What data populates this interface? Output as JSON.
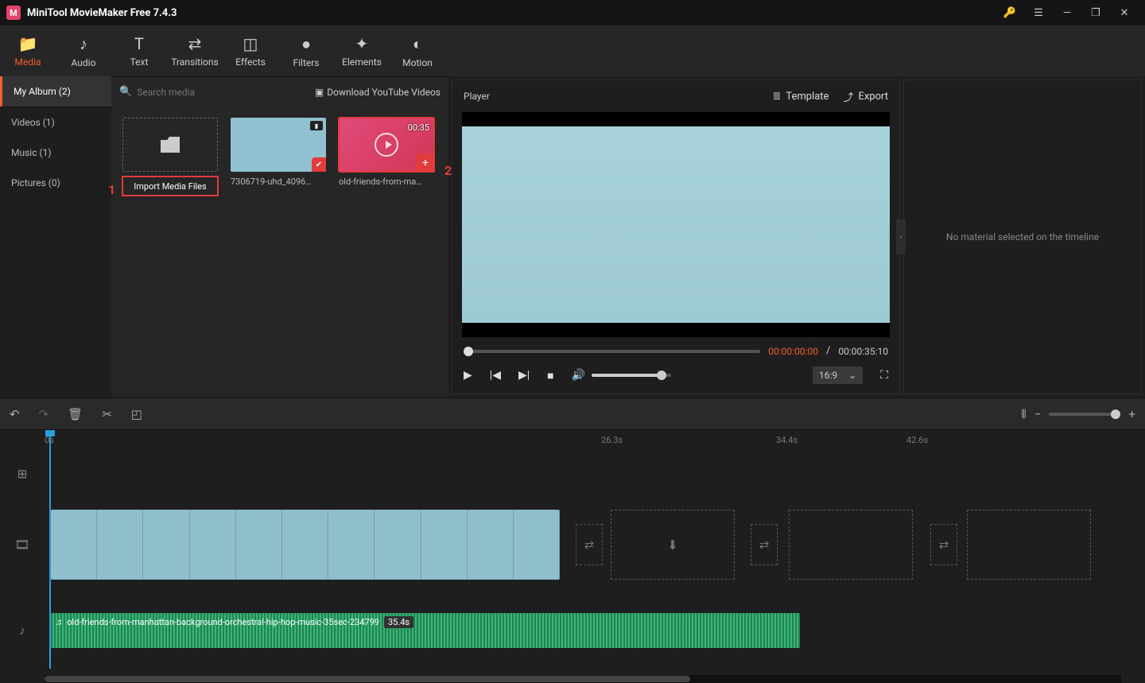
{
  "app": {
    "title": "MiniTool MovieMaker Free 7.4.3"
  },
  "toolbar": {
    "tabs": [
      {
        "label": "Media",
        "icon": "📁"
      },
      {
        "label": "Audio",
        "icon": "♪"
      },
      {
        "label": "Text",
        "icon": "T"
      },
      {
        "label": "Transitions",
        "icon": "⇄"
      },
      {
        "label": "Effects",
        "icon": "◫"
      },
      {
        "label": "Filters",
        "icon": "●"
      },
      {
        "label": "Elements",
        "icon": "✦"
      },
      {
        "label": "Motion",
        "icon": "◐"
      }
    ],
    "active": 0
  },
  "media": {
    "side": [
      {
        "label": "My Album (2)",
        "active": true
      },
      {
        "label": "Videos (1)"
      },
      {
        "label": "Music (1)"
      },
      {
        "label": "Pictures (0)"
      }
    ],
    "search_placeholder": "Search media",
    "download_label": "Download YouTube Videos",
    "import_label": "Import Media Files",
    "items": {
      "video": {
        "label": "7306719-uhd_4096…"
      },
      "audio": {
        "label": "old-friends-from-ma…",
        "duration": "00:35"
      }
    },
    "callouts": {
      "one": "1",
      "two": "2"
    }
  },
  "player": {
    "title": "Player",
    "template_label": "Template",
    "export_label": "Export",
    "time_current": "00:00:00:00",
    "time_sep": " / ",
    "time_total": "00:00:35:10",
    "ratio": "16:9"
  },
  "inspector": {
    "empty_msg": "No material selected on the timeline"
  },
  "timeline": {
    "ticks": [
      {
        "label": "0s",
        "pos": 0
      },
      {
        "label": "26.3s",
        "pos": 700
      },
      {
        "label": "34.4s",
        "pos": 920
      },
      {
        "label": "42.6s",
        "pos": 1084
      }
    ],
    "audio_clip": {
      "label": "old-friends-from-manhattan-background-orchestral-hip-hop-music-35sec-234799",
      "dur": "35.4s"
    }
  }
}
